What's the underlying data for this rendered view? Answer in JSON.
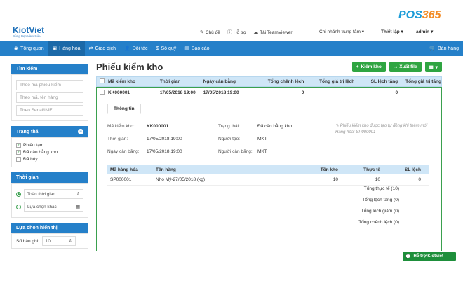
{
  "app": {
    "logo": "KiotViet",
    "slogan": "Cùng Bạn Làm Giàu",
    "pos_logo_p": "P",
    "pos_logo_os": "OS",
    "pos_logo_365": "365"
  },
  "toplinks": {
    "theme": "Chủ đề",
    "help": "Hỗ trợ",
    "teamviewer": "Tải TeamViewer",
    "branch": "Chi nhánh trung tâm",
    "settings": "Thiết lập",
    "user": "admin"
  },
  "nav": {
    "items": [
      "Tổng quan",
      "Hàng hóa",
      "Giao dịch",
      "Đối tác",
      "Sổ quỹ",
      "Báo cáo"
    ],
    "sales": "Bán hàng"
  },
  "sidebar": {
    "search_title": "Tìm kiếm",
    "search_placeholders": [
      "Theo mã phiếu kiểm",
      "Theo mã, tên hàng",
      "Theo Serial/IMEI"
    ],
    "status_title": "Trạng thái",
    "status_items": [
      {
        "label": "Phiếu tạm",
        "checked": true
      },
      {
        "label": "Đã cân bằng kho",
        "checked": true
      },
      {
        "label": "Đã hủy",
        "checked": false
      }
    ],
    "time_title": "Thời gian",
    "time_all": "Toàn thời gian",
    "time_other": "Lựa chọn khác",
    "display_title": "Lựa chọn hiển thị",
    "records_label": "Số bản ghi:",
    "records_value": "10"
  },
  "main": {
    "title": "Phiếu kiểm kho",
    "btn_add": "Kiểm kho",
    "btn_export": "Xuất file"
  },
  "table": {
    "headers": [
      "Mã kiểm kho",
      "Thời gian",
      "Ngày cân bằng",
      "Tổng chênh lệch",
      "Tổng giá trị lệch",
      "SL lệch tăng",
      "Tổng giá trị tăng"
    ],
    "row": [
      "KK000001",
      "17/05/2018 19:00",
      "17/05/2018 19:00",
      "0",
      "",
      "0",
      ""
    ]
  },
  "detail": {
    "tab": "Thông tin",
    "labels": {
      "code": "Mã kiểm kho:",
      "time": "Thời gian:",
      "balance_date": "Ngày cân bằng:",
      "status": "Trạng thái:",
      "creator": "Người tạo:",
      "balancer": "Người cân bằng:"
    },
    "values": {
      "code": "KK000001",
      "time": "17/05/2018 19:00",
      "balance_date": "17/05/2018 19:00",
      "status": "Đã cân bằng kho",
      "creator": "MKT",
      "balancer": "MKT"
    },
    "note": "Phiếu kiểm kho được tạo tự động khi thêm mới Hàng hóa: SP000001",
    "sub_headers": [
      "Mã hàng hóa",
      "Tên hàng",
      "Tồn kho",
      "Thực tế",
      "SL lệch"
    ],
    "sub_row": [
      "SP000001",
      "Nho Mỹ-27/05/2018 (kg)",
      "10",
      "10",
      "0"
    ],
    "summary": [
      "Tổng thực tế (10)",
      "Tổng lệch tăng (0)",
      "Tổng lệch giảm (0)",
      "Tổng chênh lệch (0)"
    ]
  },
  "support": "Hỗ trợ KiotViet",
  "colors": {
    "primary": "#2580c9",
    "accent": "#2fa542",
    "pos_blue": "#1a9bd7",
    "pos_orange": "#f28b24"
  }
}
